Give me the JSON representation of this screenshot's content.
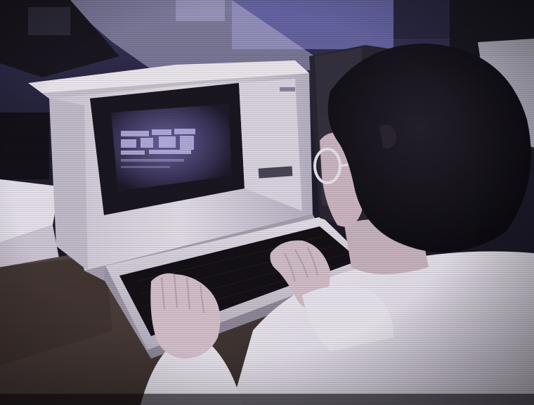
{
  "scene": {
    "kind": "photograph",
    "subject": "person-typing-on-vintage-computer-terminal",
    "palette": {
      "shadow": "#0b0a10",
      "desk": "#4a3a36",
      "terminal_beige": "#d8d2dc",
      "screen_glass": "#2a2438",
      "screen_glow": "#8f86c8",
      "shirt": "#ece8f0",
      "skin": "#cdb8c4",
      "hair": "#121016",
      "back_wall": "#7a78b8"
    }
  }
}
